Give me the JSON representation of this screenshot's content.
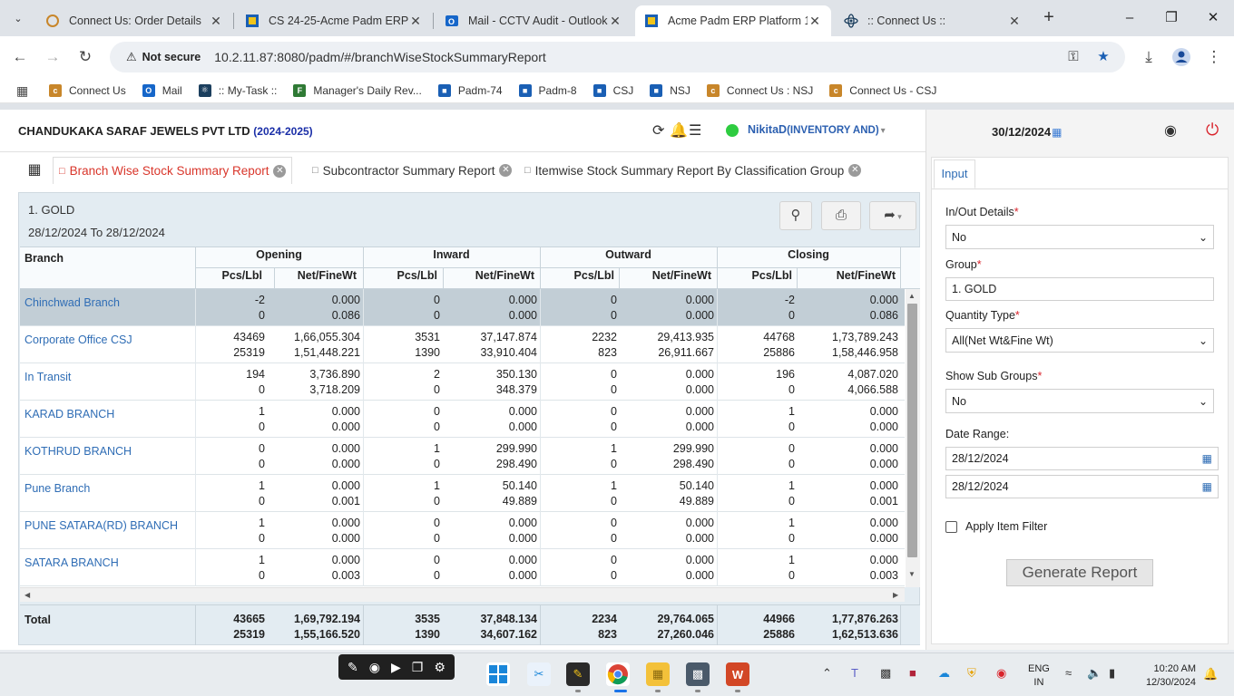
{
  "browser": {
    "tabs": [
      {
        "title": "Connect Us: Order Details",
        "icon": "connect-icon"
      },
      {
        "title": "CS 24-25-Acme Padm ERP P",
        "icon": "padm-icon"
      },
      {
        "title": "Mail - CCTV Audit - Outlook",
        "icon": "outlook-icon"
      },
      {
        "title": "Acme Padm ERP Platform 1.",
        "icon": "padm-icon"
      },
      {
        "title": ":: Connect Us ::",
        "icon": "react-icon"
      }
    ],
    "security_label": "Not secure",
    "url": "10.2.11.87:8080/padm/#/branchWiseStockSummaryReport",
    "bookmarks": [
      {
        "label": "Connect Us",
        "color": "#c8862a"
      },
      {
        "label": "Mail",
        "color": "#1666c9"
      },
      {
        "label": ":: My-Task ::",
        "color": "#1c3f5e"
      },
      {
        "label": "Manager's Daily Rev...",
        "color": "#2f7a35"
      },
      {
        "label": "Padm-74",
        "color": "#1a5fb4"
      },
      {
        "label": "Padm-8",
        "color": "#1a5fb4"
      },
      {
        "label": "CSJ",
        "color": "#1a5fb4"
      },
      {
        "label": "NSJ",
        "color": "#1a5fb4"
      },
      {
        "label": "Connect Us : NSJ",
        "color": "#c8862a"
      },
      {
        "label": "Connect Us - CSJ",
        "color": "#c8862a"
      }
    ]
  },
  "header": {
    "company": "CHANDUKAKA SARAF JEWELS PVT LTD",
    "fiscal_year": "(2024-2025)",
    "user": "NikitaD",
    "role": "(INVENTORY AND)",
    "date": "30/12/2024"
  },
  "report_tabs": [
    "Branch Wise Stock Summary Report",
    "Subcontractor Summary Report",
    "Itemwise Stock Summary Report By Classification Group"
  ],
  "report": {
    "group_title": "1. GOLD",
    "date_range": "28/12/2024 To 28/12/2024",
    "columns": {
      "branch": "Branch",
      "groups": [
        "Opening",
        "Inward",
        "Outward",
        "Closing"
      ],
      "pcs": "Pcs/Lbl",
      "net": "Net/FineWt"
    },
    "rows": [
      {
        "branch": "Chinchwad Branch",
        "vals": [
          [
            "-2",
            "0.000",
            "0",
            "0.000",
            "0",
            "0.000",
            "-2",
            "0.000"
          ],
          [
            "0",
            "0.086",
            "0",
            "0.000",
            "0",
            "0.000",
            "0",
            "0.086"
          ]
        ]
      },
      {
        "branch": "Corporate Office CSJ",
        "vals": [
          [
            "43469",
            "1,66,055.304",
            "3531",
            "37,147.874",
            "2232",
            "29,413.935",
            "44768",
            "1,73,789.243"
          ],
          [
            "25319",
            "1,51,448.221",
            "1390",
            "33,910.404",
            "823",
            "26,911.667",
            "25886",
            "1,58,446.958"
          ]
        ]
      },
      {
        "branch": "In Transit",
        "vals": [
          [
            "194",
            "3,736.890",
            "2",
            "350.130",
            "0",
            "0.000",
            "196",
            "4,087.020"
          ],
          [
            "0",
            "3,718.209",
            "0",
            "348.379",
            "0",
            "0.000",
            "0",
            "4,066.588"
          ]
        ]
      },
      {
        "branch": "KARAD BRANCH",
        "vals": [
          [
            "1",
            "0.000",
            "0",
            "0.000",
            "0",
            "0.000",
            "1",
            "0.000"
          ],
          [
            "0",
            "0.000",
            "0",
            "0.000",
            "0",
            "0.000",
            "0",
            "0.000"
          ]
        ]
      },
      {
        "branch": "KOTHRUD BRANCH",
        "vals": [
          [
            "0",
            "0.000",
            "1",
            "299.990",
            "1",
            "299.990",
            "0",
            "0.000"
          ],
          [
            "0",
            "0.000",
            "0",
            "298.490",
            "0",
            "298.490",
            "0",
            "0.000"
          ]
        ]
      },
      {
        "branch": "Pune Branch",
        "vals": [
          [
            "1",
            "0.000",
            "1",
            "50.140",
            "1",
            "50.140",
            "1",
            "0.000"
          ],
          [
            "0",
            "0.001",
            "0",
            "49.889",
            "0",
            "49.889",
            "0",
            "0.001"
          ]
        ]
      },
      {
        "branch": "PUNE SATARA(RD) BRANCH",
        "vals": [
          [
            "1",
            "0.000",
            "0",
            "0.000",
            "0",
            "0.000",
            "1",
            "0.000"
          ],
          [
            "0",
            "0.000",
            "0",
            "0.000",
            "0",
            "0.000",
            "0",
            "0.000"
          ]
        ]
      },
      {
        "branch": "SATARA BRANCH",
        "vals": [
          [
            "1",
            "0.000",
            "0",
            "0.000",
            "0",
            "0.000",
            "1",
            "0.000"
          ],
          [
            "0",
            "0.003",
            "0",
            "0.000",
            "0",
            "0.000",
            "0",
            "0.003"
          ]
        ]
      }
    ],
    "total": {
      "label": "Total",
      "vals": [
        [
          "43665",
          "1,69,792.194",
          "3535",
          "37,848.134",
          "2234",
          "29,764.065",
          "44966",
          "1,77,876.263"
        ],
        [
          "25319",
          "1,55,166.520",
          "1390",
          "34,607.162",
          "823",
          "27,260.046",
          "25886",
          "1,62,513.636"
        ]
      ]
    }
  },
  "input_panel": {
    "tab": "Input",
    "inout_label": "In/Out Details",
    "inout_value": "No",
    "group_label": "Group",
    "group_value": "1. GOLD",
    "qty_label": "Quantity Type",
    "qty_value": "All(Net Wt&Fine Wt)",
    "subgroups_label": "Show Sub Groups",
    "subgroups_value": "No",
    "date_range_label": "Date Range:",
    "from_date": "28/12/2024",
    "to_date": "28/12/2024",
    "item_filter_label": "Apply Item Filter",
    "generate_label": "Generate Report"
  },
  "taskbar": {
    "lang_top": "ENG",
    "lang_bottom": "IN",
    "time": "10:20 AM",
    "date": "12/30/2024"
  }
}
